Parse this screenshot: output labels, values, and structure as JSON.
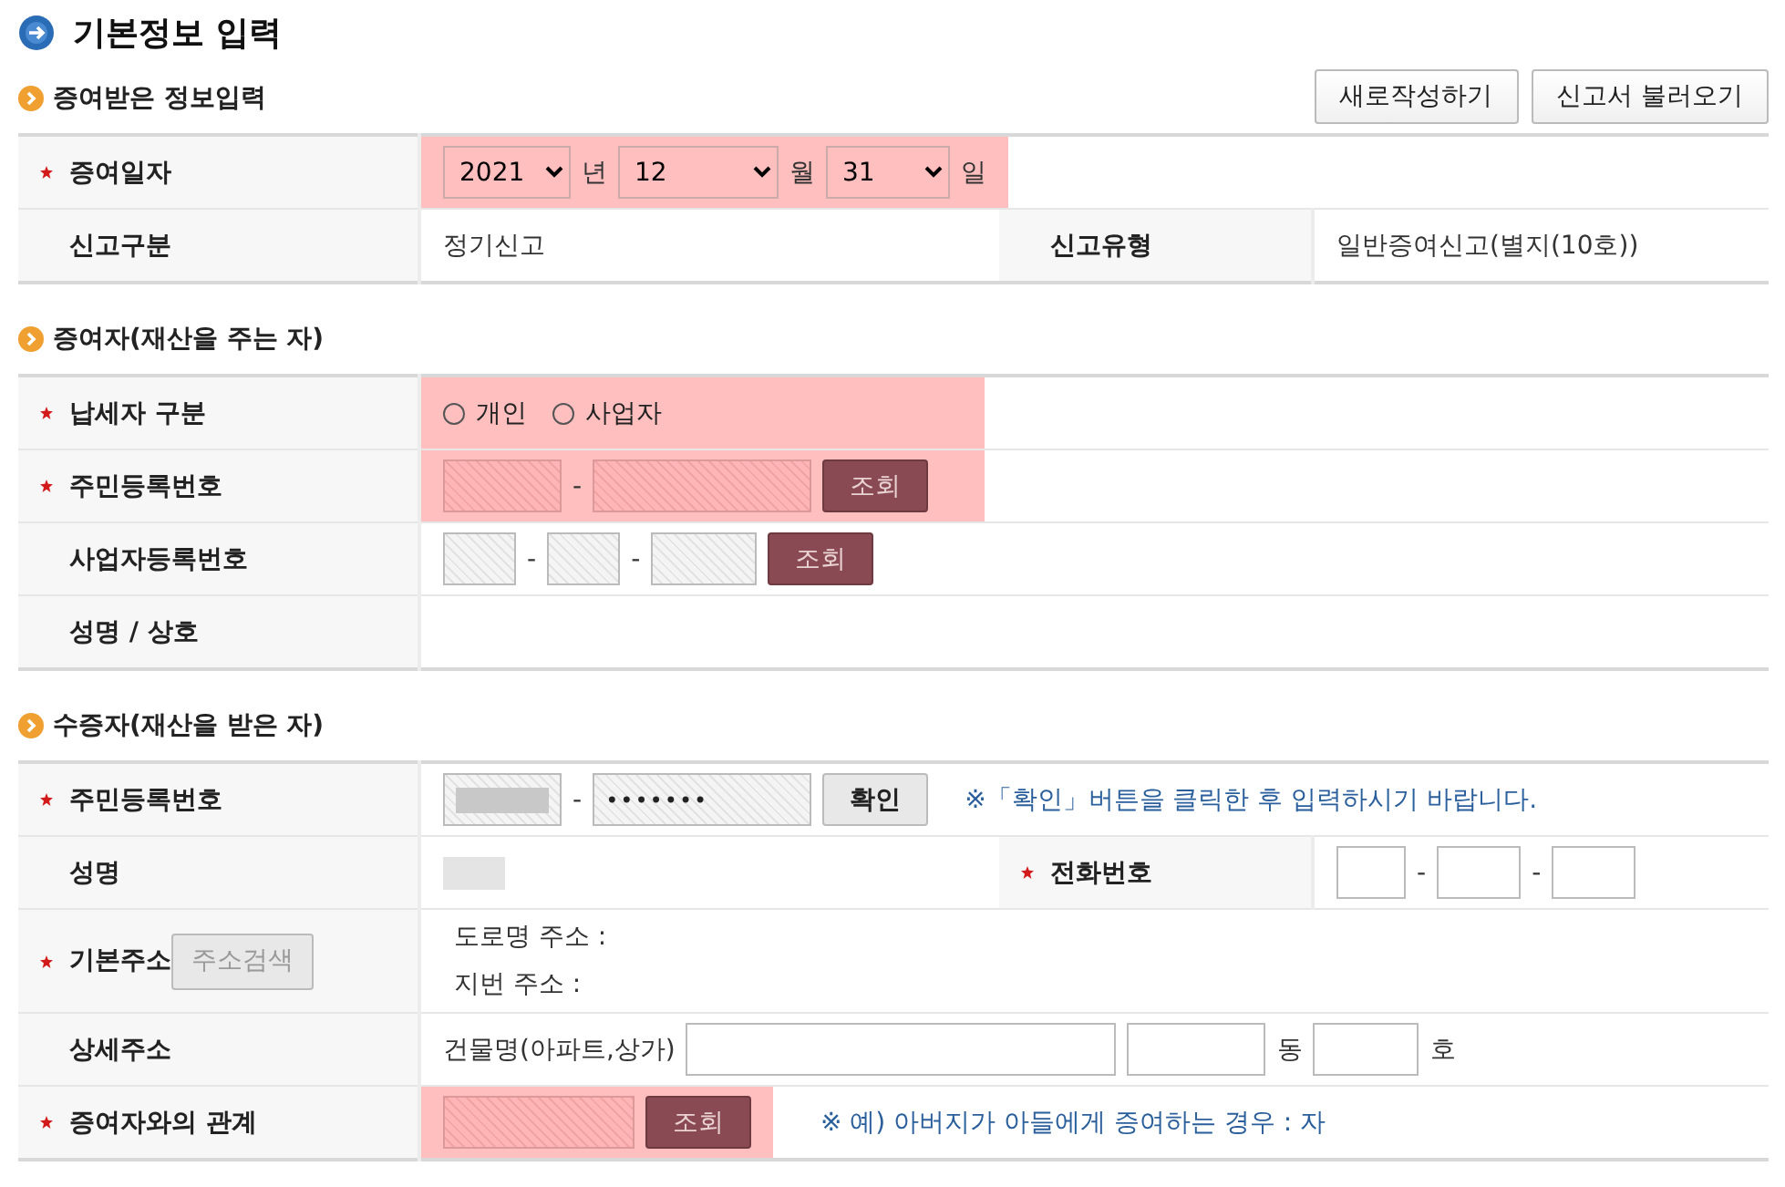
{
  "title": "기본정보 입력",
  "sections": [
    {
      "title": "증여받은 정보입력",
      "buttons": [
        "새로작성하기",
        "신고서 불러오기"
      ],
      "rows": [
        {
          "cells": [
            {
              "kind": "label",
              "text": "증여일자",
              "required": true
            },
            {
              "kind": "value",
              "colspan": 3,
              "groups": [
                {
                  "highlighted": true,
                  "items": [
                    {
                      "kind": "select",
                      "value": "2021"
                    },
                    {
                      "kind": "text",
                      "text": "년"
                    },
                    {
                      "kind": "select",
                      "value": "12"
                    },
                    {
                      "kind": "text",
                      "text": "월"
                    },
                    {
                      "kind": "select",
                      "value": "31"
                    },
                    {
                      "kind": "text",
                      "text": "일"
                    }
                  ]
                }
              ]
            }
          ]
        },
        {
          "cells": [
            {
              "kind": "label",
              "text": "신고구분",
              "required": false
            },
            {
              "kind": "value",
              "groups": [
                {
                  "highlighted": false,
                  "items": [
                    {
                      "kind": "text",
                      "text": "정기신고"
                    }
                  ]
                }
              ]
            },
            {
              "kind": "label",
              "text": "신고유형",
              "required": false
            },
            {
              "kind": "value",
              "groups": [
                {
                  "highlighted": false,
                  "items": [
                    {
                      "kind": "text",
                      "text": "일반증여신고(별지(10호))"
                    }
                  ]
                }
              ]
            }
          ]
        }
      ]
    },
    {
      "title": "증여자(재산을 주는 자)",
      "rows": [
        {
          "cells": [
            {
              "kind": "label",
              "text": "납세자 구분",
              "required": true
            },
            {
              "kind": "value",
              "colspan": 3,
              "groups": [
                {
                  "highlighted": true,
                  "items": [
                    {
                      "kind": "radio",
                      "label": "개인",
                      "selected": false
                    },
                    {
                      "kind": "radio",
                      "label": "사업자",
                      "selected": false
                    }
                  ]
                }
              ]
            }
          ]
        },
        {
          "cells": [
            {
              "kind": "label",
              "text": "주민등록번호",
              "required": true
            },
            {
              "kind": "value",
              "colspan": 3,
              "groups": [
                {
                  "highlighted": true,
                  "items": [
                    {
                      "kind": "field",
                      "disabled": true
                    },
                    {
                      "kind": "text",
                      "text": "-"
                    },
                    {
                      "kind": "field",
                      "disabled": true
                    },
                    {
                      "kind": "lookup",
                      "label": "조회"
                    }
                  ]
                }
              ]
            }
          ]
        },
        {
          "cells": [
            {
              "kind": "label",
              "text": "사업자등록번호",
              "required": false
            },
            {
              "kind": "value",
              "colspan": 3,
              "groups": [
                {
                  "highlighted": false,
                  "items": [
                    {
                      "kind": "field",
                      "disabled": true
                    },
                    {
                      "kind": "text",
                      "text": "-"
                    },
                    {
                      "kind": "field",
                      "disabled": true
                    },
                    {
                      "kind": "text",
                      "text": "-"
                    },
                    {
                      "kind": "field",
                      "disabled": true
                    },
                    {
                      "kind": "lookup",
                      "label": "조회"
                    }
                  ]
                }
              ]
            }
          ]
        },
        {
          "cells": [
            {
              "kind": "label",
              "text": "성명 / 상호",
              "required": false
            },
            {
              "kind": "value",
              "colspan": 3
            }
          ]
        }
      ]
    },
    {
      "title": "수증자(재산을 받은 자)",
      "rows": [
        {
          "cells": [
            {
              "kind": "label",
              "text": "주민등록번호",
              "required": true
            },
            {
              "kind": "value",
              "colspan": 3,
              "groups": [
                {
                  "highlighted": false,
                  "items": [
                    {
                      "kind": "field",
                      "disabled": true,
                      "redacted": true
                    },
                    {
                      "kind": "text",
                      "text": "-"
                    },
                    {
                      "kind": "field",
                      "disabled": true,
                      "value": "•••••••"
                    },
                    {
                      "kind": "confirm",
                      "label": "확인"
                    },
                    {
                      "kind": "note",
                      "text": "※「확인」버튼을 클릭한 후 입력하시기 바랍니다."
                    }
                  ]
                }
              ]
            }
          ]
        },
        {
          "cells": [
            {
              "kind": "label",
              "text": "성명",
              "required": false
            },
            {
              "kind": "value",
              "groups": [
                {
                  "highlighted": false,
                  "items": [
                    {
                      "kind": "redacted"
                    }
                  ]
                }
              ]
            },
            {
              "kind": "label",
              "text": "전화번호",
              "required": true
            },
            {
              "kind": "value",
              "groups": [
                {
                  "highlighted": false,
                  "items": [
                    {
                      "kind": "field",
                      "disabled": false
                    },
                    {
                      "kind": "text",
                      "text": "-"
                    },
                    {
                      "kind": "field",
                      "disabled": false
                    },
                    {
                      "kind": "text",
                      "text": "-"
                    },
                    {
                      "kind": "field",
                      "disabled": false
                    }
                  ]
                }
              ]
            }
          ]
        },
        {
          "cells": [
            {
              "kind": "label",
              "text": "기본주소",
              "required": true,
              "button": "주소검색"
            },
            {
              "kind": "value",
              "colspan": 3,
              "groups": [
                {
                  "highlighted": false,
                  "items": [
                    {
                      "kind": "lines",
                      "lines": [
                        "도로명 주소 :",
                        "지번 주소 :"
                      ]
                    }
                  ]
                }
              ]
            }
          ]
        },
        {
          "cells": [
            {
              "kind": "label",
              "text": "상세주소",
              "required": false
            },
            {
              "kind": "value",
              "colspan": 3,
              "groups": [
                {
                  "highlighted": false,
                  "items": [
                    {
                      "kind": "text",
                      "text": "건물명(아파트,상가)"
                    },
                    {
                      "kind": "field",
                      "disabled": false
                    },
                    {
                      "kind": "field",
                      "disabled": false
                    },
                    {
                      "kind": "text",
                      "text": "동"
                    },
                    {
                      "kind": "field",
                      "disabled": false
                    },
                    {
                      "kind": "text",
                      "text": "호"
                    }
                  ]
                }
              ]
            }
          ]
        },
        {
          "cells": [
            {
              "kind": "label",
              "text": "증여자와의 관계",
              "required": true
            },
            {
              "kind": "value",
              "colspan": 3,
              "groups": [
                {
                  "highlighted": true,
                  "items": [
                    {
                      "kind": "field",
                      "disabled": true
                    },
                    {
                      "kind": "lookup",
                      "label": "조회"
                    }
                  ]
                },
                {
                  "highlighted": false,
                  "items": [
                    {
                      "kind": "note",
                      "text": "※ 예) 아버지가 아들에게 증여하는 경우 : 자"
                    }
                  ]
                }
              ]
            }
          ]
        }
      ]
    }
  ]
}
